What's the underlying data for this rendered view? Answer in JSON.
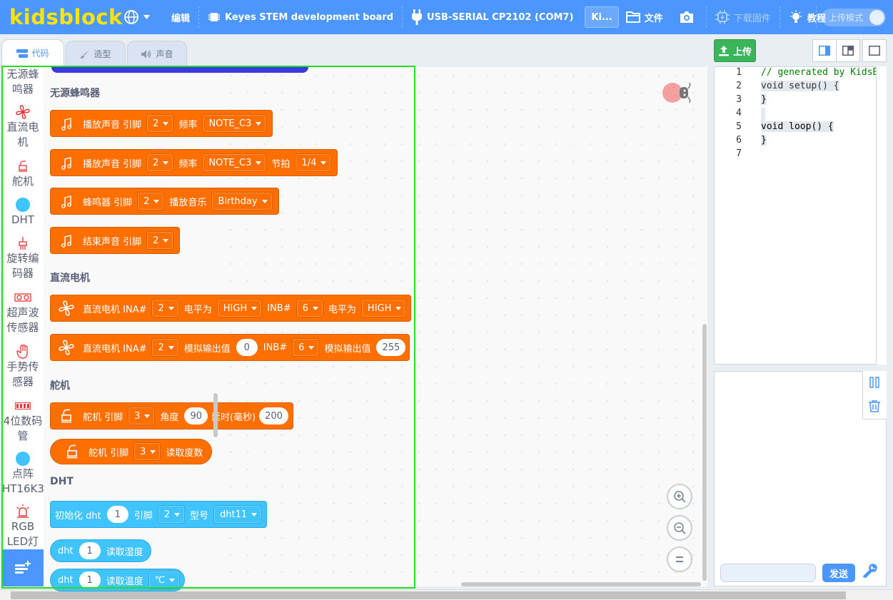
{
  "menubar": {
    "logo": "kidsblock",
    "edit": "编辑",
    "board": "Keyes STEM development board",
    "port": "USB-SERIAL CP2102 (COM7)",
    "kit": "Ki...",
    "file": "文件",
    "firmware": "下载固件",
    "tutorial": "教程",
    "upload_mode": "上传模式"
  },
  "tabs": {
    "code": "代码",
    "costume": "造型",
    "sound": "声音"
  },
  "categories": [
    {
      "label": "无源蜂鸣器",
      "icon": "buzzer-icon"
    },
    {
      "label": "直流电机",
      "icon": "fan-icon"
    },
    {
      "label": "舵机",
      "icon": "servo-icon"
    },
    {
      "label": "DHT",
      "icon": "dot-icon"
    },
    {
      "label": "旋转编码器",
      "icon": "encoder-icon"
    },
    {
      "label": "超声波传感器",
      "icon": "ultrasonic-icon"
    },
    {
      "label": "手势传感器",
      "icon": "hand-icon"
    },
    {
      "label": "4位数码管",
      "icon": "segment-icon"
    },
    {
      "label": "点阵HT16K33",
      "icon": "dot-icon"
    },
    {
      "label": "RGB LED灯",
      "icon": "light-icon"
    }
  ],
  "sections": {
    "buzzer": "无源蜂鸣器",
    "dc_motor": "直流电机",
    "servo": "舵机",
    "dht": "DHT"
  },
  "blocks": {
    "b1": {
      "text": "播放声音 引脚",
      "pin": "2",
      "freq_label": "频率",
      "freq": "NOTE_C3"
    },
    "b2": {
      "text": "播放声音 引脚",
      "pin": "2",
      "freq_label": "频率",
      "freq": "NOTE_C3",
      "beat_label": "节拍",
      "beat": "1/4"
    },
    "b3": {
      "text": "蜂鸣器 引脚",
      "pin": "2",
      "music_label": "播放音乐",
      "music": "Birthday"
    },
    "b4": {
      "text": "结束声音 引脚",
      "pin": "2"
    },
    "m1": {
      "text": "直流电机 INA#",
      "ina": "2",
      "level_label": "电平为",
      "ina_level": "HIGH",
      "inb_label": "INB#",
      "inb": "6",
      "level_label2": "电平为",
      "inb_level": "HIGH"
    },
    "m2": {
      "text": "直流电机 INA#",
      "ina": "2",
      "analog_label": "模拟输出值",
      "ina_val": "0",
      "inb_label": "INB#",
      "inb": "6",
      "analog_label2": "模拟输出值",
      "inb_val": "255"
    },
    "s1": {
      "text": "舵机 引脚",
      "pin": "3",
      "angle_label": "角度",
      "angle": "90",
      "delay_label": "延时(毫秒)",
      "delay": "200"
    },
    "s2": {
      "text": "舵机 引脚",
      "pin": "3",
      "read_label": "读取度数"
    },
    "d1": {
      "text": "初始化 dht",
      "id": "1",
      "pin_label": "引脚",
      "pin": "2",
      "model_label": "型号",
      "model": "dht11"
    },
    "d2": {
      "text": "dht",
      "id": "1",
      "read_label": "读取湿度"
    },
    "d3": {
      "text": "dht",
      "id": "1",
      "read_label": "读取温度",
      "unit": "℃"
    }
  },
  "right": {
    "upload": "上传",
    "send": "发送"
  },
  "code": [
    {
      "n": "1",
      "text": "// generated by KidsBlo"
    },
    {
      "n": "2",
      "text": "void setup() {"
    },
    {
      "n": "3",
      "text": "}"
    },
    {
      "n": "4",
      "text": ""
    },
    {
      "n": "5",
      "text": "void loop() {"
    },
    {
      "n": "6",
      "text": "}"
    },
    {
      "n": "7",
      "text": ""
    }
  ],
  "colors": {
    "menubar": "#4c97ff",
    "logo": "#ffe400",
    "block_orange": "#ff6f00",
    "block_cyan": "#40c4ff",
    "frame": "#1de21d",
    "upload_green": "#3bb55b"
  }
}
